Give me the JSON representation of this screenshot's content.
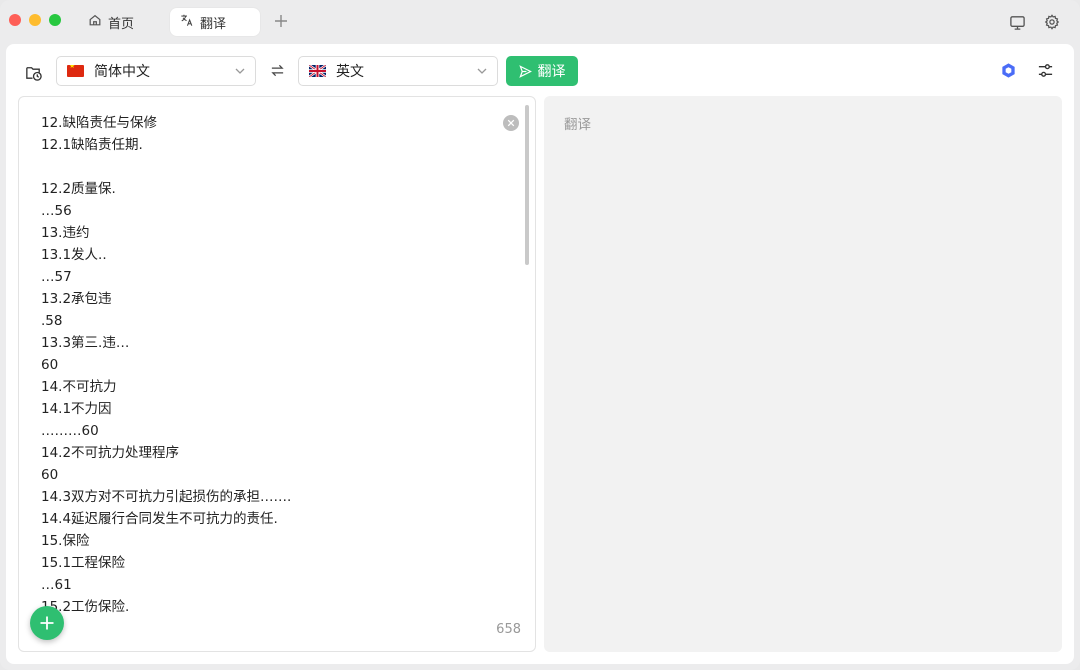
{
  "tabs": [
    {
      "label": "首页",
      "icon": "home-icon"
    },
    {
      "label": "翻译",
      "icon": "translate-icon"
    }
  ],
  "toolbar": {
    "source_lang": "简体中文",
    "target_lang": "英文",
    "translate_label": "翻译"
  },
  "source": {
    "lines": [
      "12.缺陷责任与保修",
      "12.1缺陷责任期.",
      "",
      "12.2质量保.",
      "…56",
      "13.违约",
      "13.1发人..",
      "…57",
      "13.2承包违",
      ".58",
      "13.3第三.违…",
      "60",
      "14.不可抗力",
      "14.1不力因",
      "………60",
      "14.2不可抗力处理程序",
      "60",
      "14.3双方对不可抗力引起损伤的承担…….",
      "14.4延迟履行合同发生不可抗力的责任.",
      "15.保险",
      "15.1工程保险",
      "…61",
      "15.2工伤保险."
    ],
    "char_count": "658"
  },
  "target": {
    "placeholder": "翻译"
  },
  "colors": {
    "accent": "#2fbf71",
    "ai_icon": "#4a6cf7"
  }
}
